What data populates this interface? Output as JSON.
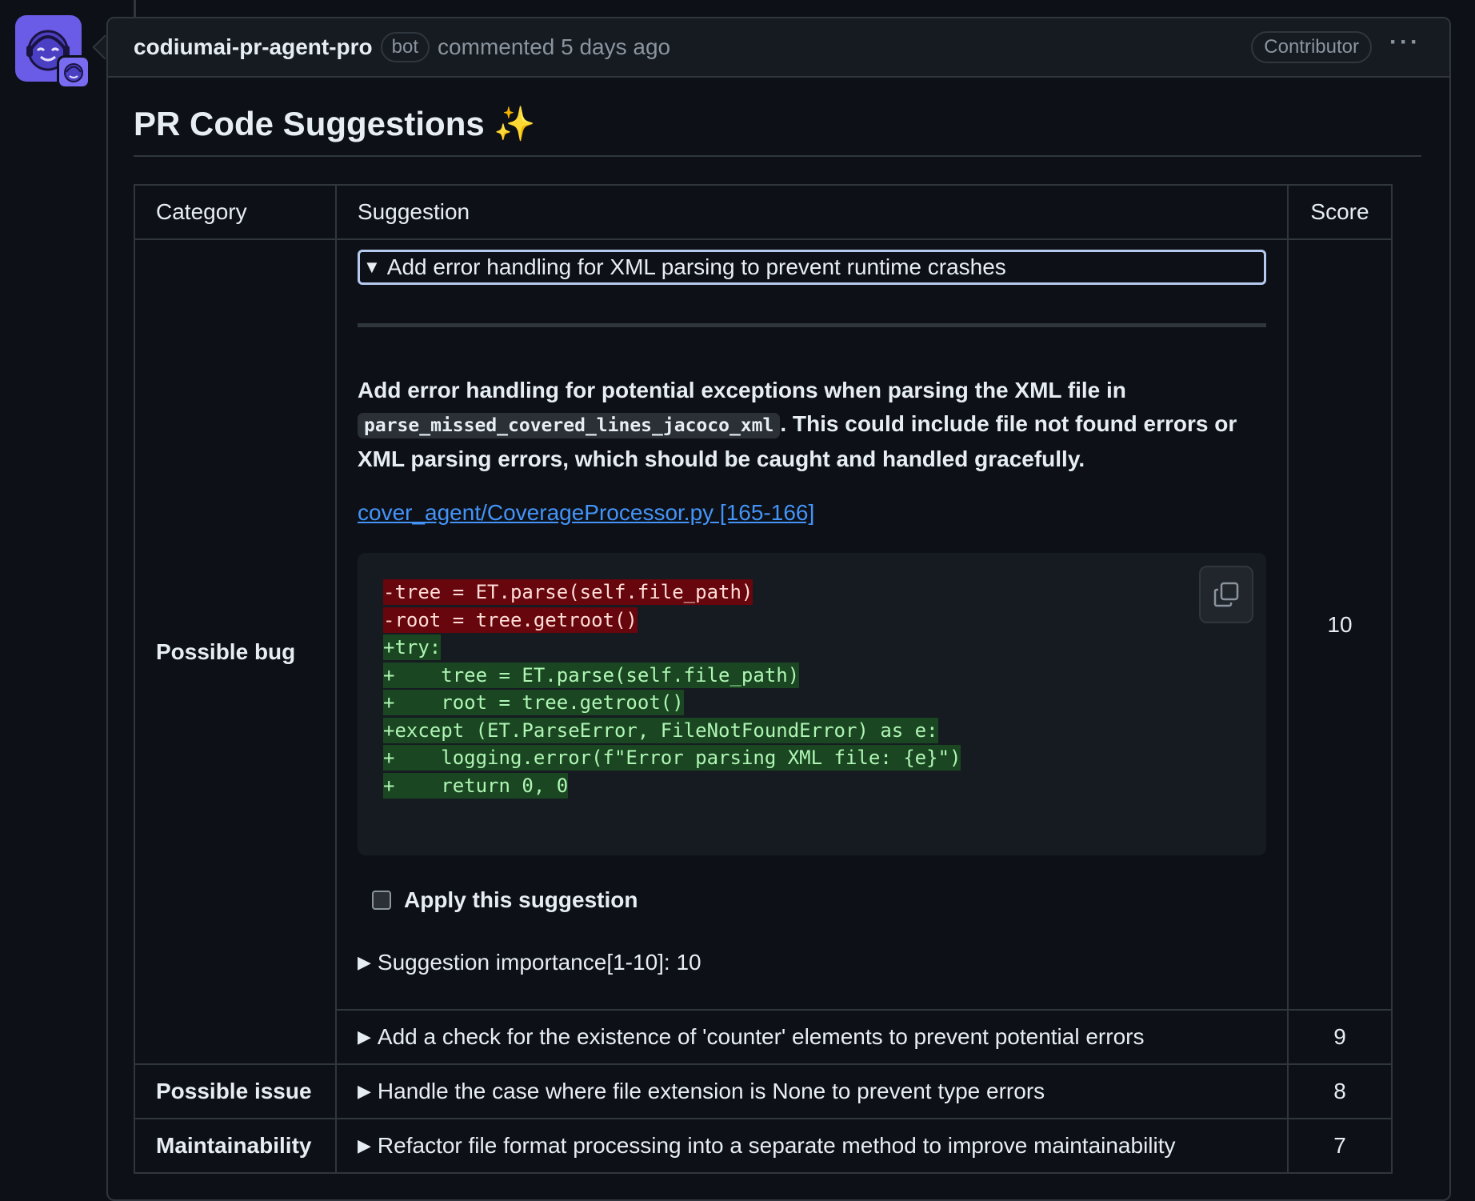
{
  "comment": {
    "author": "codiumai-pr-agent-pro",
    "bot_badge": "bot",
    "commented_text": "commented 5 days ago",
    "role_badge": "Contributor",
    "more_icon": "kebab-horizontal-icon"
  },
  "title": "PR Code Suggestions",
  "title_emoji": "✨",
  "table": {
    "headers": {
      "category": "Category",
      "suggestion": "Suggestion",
      "score": "Score"
    },
    "expanded": {
      "category": "Possible bug",
      "summary": "Add error handling for XML parsing to prevent runtime crashes",
      "description_part1": "Add error handling for potential exceptions when parsing the XML file in ",
      "description_code": "parse_missed_covered_lines_jacoco_xml",
      "description_part2": ". This could include file not found errors or XML parsing errors, which should be caught and handled gracefully.",
      "file_link": "cover_agent/CoverageProcessor.py [165-166]",
      "code_lines": [
        "-tree = ET.parse(self.file_path)",
        "-root = tree.getroot()",
        "+try:",
        "+    tree = ET.parse(self.file_path)",
        "+    root = tree.getroot()",
        "+except (ET.ParseError, FileNotFoundError) as e:",
        "+    logging.error(f\"Error parsing XML file: {e}\")",
        "+    return 0, 0"
      ],
      "apply_label": "Apply this suggestion",
      "importance": "Suggestion importance[1-10]: 10",
      "score": "10"
    },
    "rows": [
      {
        "summary": "Add a check for the existence of 'counter' elements to prevent potential errors",
        "score": "9"
      },
      {
        "category": "Possible issue",
        "summary": "Handle the case where file extension is None to prevent type errors",
        "score": "8"
      },
      {
        "category": "Maintainability",
        "summary": "Refactor file format processing into a separate method to improve maintainability",
        "score": "7"
      }
    ]
  }
}
